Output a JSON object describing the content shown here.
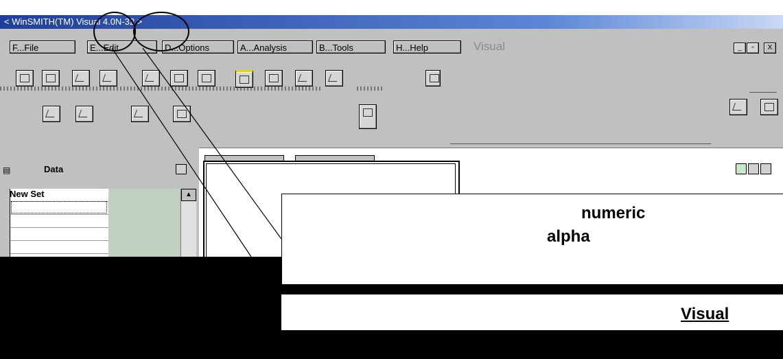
{
  "window": {
    "title": "< WinSMITH(TM) Visual 4.0N-32 >"
  },
  "menu": {
    "items": [
      "F...File",
      "E...Edit",
      "D...Options",
      "A...Analysis",
      "B...Tools",
      "H...Help"
    ],
    "title": "Visual",
    "window_buttons": [
      "_",
      "▫",
      "X"
    ]
  },
  "data_panel": {
    "title": "Data",
    "column_header": "New Set"
  },
  "callout": {
    "numeric": "numeric",
    "alpha": "alpha",
    "visual_link": "Visual"
  },
  "colors": {
    "titlebar_start": "#1f3f9a",
    "titlebar_end": "#c9d8f5",
    "face": "#c0c0c0",
    "annotation": "#000000"
  },
  "icons": [
    "new-doc-icon",
    "monitor-icon",
    "plot-icon",
    "edit-plot-icon",
    "color-plot-icon",
    "report-icon",
    "clipboard-icon",
    "print-icon",
    "export-icon",
    "calc-icon",
    "table-icon",
    "globe-icon",
    "scatter-icon",
    "fit-icon",
    "pen-icon",
    "distribution-icon",
    "blank-icon",
    "chart-tool-icon",
    "data-table-icon"
  ]
}
